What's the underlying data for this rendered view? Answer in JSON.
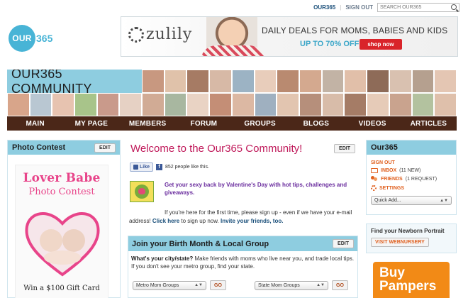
{
  "topbar": {
    "account_link": "OUR365",
    "sign_out": "SIGN OUT",
    "search_placeholder": "SEARCH OUR365"
  },
  "logo": {
    "text": "OUR",
    "num": "365"
  },
  "ad": {
    "brand": "zulily",
    "headline": "DAILY DEALS FOR MOMS, BABIES AND KIDS",
    "offer": "UP TO 70% OFF",
    "cta": "shop now"
  },
  "community": {
    "title": "OUR365 COMMUNITY"
  },
  "nav": {
    "items": [
      "MAIN",
      "MY PAGE",
      "MEMBERS",
      "FORUM",
      "GROUPS",
      "BLOGS",
      "VIDEOS",
      "ARTICLES"
    ]
  },
  "left": {
    "title": "Photo Contest",
    "edit": "EDIT",
    "contest_title": "Lover Babe",
    "contest_sub": "Photo Contest",
    "contest_prize": "Win a $100 Gift Card"
  },
  "center": {
    "welcome": "Welcome to the Our365 Community!",
    "edit": "EDIT",
    "like_label": "Like",
    "like_count": "852 people like this.",
    "promo": "Get your sexy back by Valentine's Day with hot tips, challenges and giveaways.",
    "intro_text": "If you're here for the first time, please sign up - even if we have your e-mail address!",
    "intro_link1": "Click here",
    "intro_mid": "to sign up now.",
    "intro_link2": "Invite your friends, too."
  },
  "join": {
    "title": "Join your Birth Month & Local Group",
    "edit": "EDIT",
    "question": "What's your city/state?",
    "text1": "Make friends with moms who live near you, and trade local tips.",
    "text2": "If you don't see your metro group, find your state.",
    "select_metro": "Metro Mom Groups",
    "select_state": "State Mom Groups",
    "go": "GO"
  },
  "right": {
    "title": "Our365",
    "sign_out": "SIGN OUT",
    "inbox_label": "INBOX",
    "inbox_count": "(11 NEW)",
    "friends_label": "FRIENDS",
    "friends_count": "(1 REQUEST)",
    "settings_label": "SETTINGS",
    "quick_add": "Quick Add...",
    "newborn_title": "Find your Newborn Portrait",
    "newborn_btn": "VISIT WEBNURSERY",
    "ad_text": "Buy Pampers"
  },
  "colors": {
    "accent_blue": "#8ecde0",
    "nav_brown": "#4b2718",
    "welcome_pink": "#c0195a",
    "orange": "#e0601f"
  }
}
